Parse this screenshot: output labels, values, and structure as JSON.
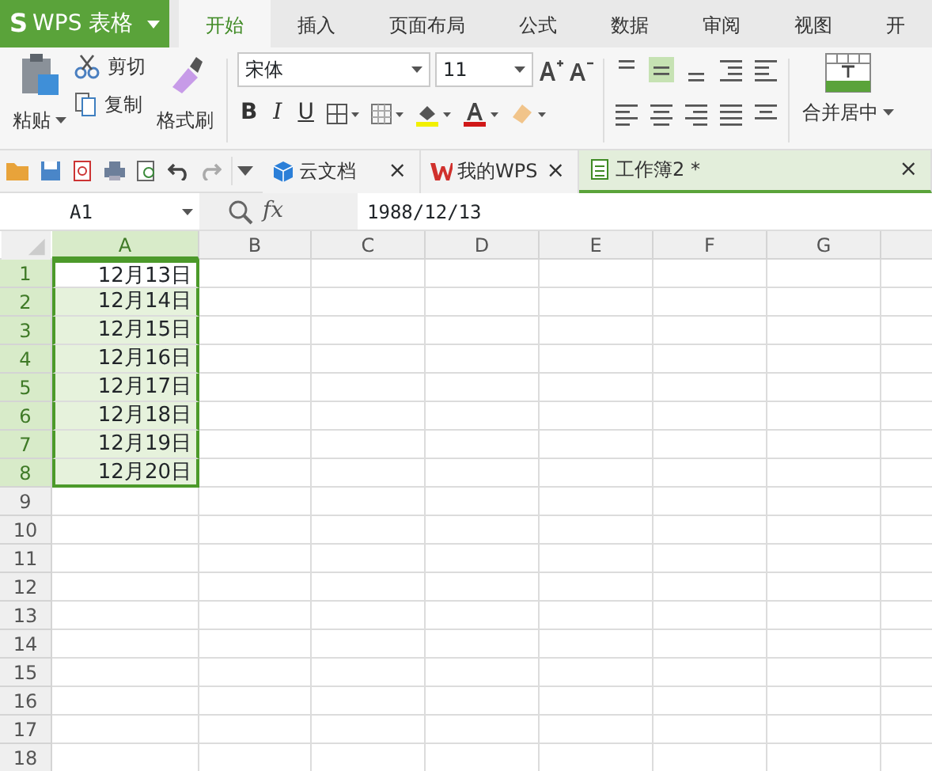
{
  "app": {
    "logo": "S",
    "title": "WPS 表格"
  },
  "ribbon_tabs": [
    {
      "label": "开始",
      "selected": true
    },
    {
      "label": "插入",
      "selected": false
    },
    {
      "label": "页面布局",
      "selected": false
    },
    {
      "label": "公式",
      "selected": false
    },
    {
      "label": "数据",
      "selected": false
    },
    {
      "label": "审阅",
      "selected": false
    },
    {
      "label": "视图",
      "selected": false
    },
    {
      "label": "开",
      "selected": false
    }
  ],
  "clipboard": {
    "paste": "粘贴",
    "cut": "剪切",
    "copy": "复制",
    "format_painter": "格式刷"
  },
  "font": {
    "name": "宋体",
    "size": "11",
    "bold": "B",
    "italic": "I",
    "underline": "U"
  },
  "merge": "合并居中",
  "doc_tabs": [
    {
      "label": "云文档",
      "close": "×",
      "selected": false
    },
    {
      "label": "我的WPS",
      "close": "×",
      "selected": false
    },
    {
      "label": "工作簿2 *",
      "close": "×",
      "selected": true
    }
  ],
  "name_box": "A1",
  "fx": "fx",
  "formula": "1988/12/13",
  "sheet": {
    "columns": [
      {
        "label": "A",
        "selected": true
      },
      {
        "label": "B",
        "selected": false
      },
      {
        "label": "C",
        "selected": false
      },
      {
        "label": "D",
        "selected": false
      },
      {
        "label": "E",
        "selected": false
      },
      {
        "label": "F",
        "selected": false
      },
      {
        "label": "G",
        "selected": false
      }
    ],
    "rows": [
      {
        "label": "1",
        "selected": true,
        "cells": [
          {
            "text": "12月13日",
            "active": true
          }
        ]
      },
      {
        "label": "2",
        "selected": true,
        "cells": [
          {
            "text": "12月14日",
            "active": false
          }
        ]
      },
      {
        "label": "3",
        "selected": true,
        "cells": [
          {
            "text": "12月15日",
            "active": false
          }
        ]
      },
      {
        "label": "4",
        "selected": true,
        "cells": [
          {
            "text": "12月16日",
            "active": false
          }
        ]
      },
      {
        "label": "5",
        "selected": true,
        "cells": [
          {
            "text": "12月17日",
            "active": false
          }
        ]
      },
      {
        "label": "6",
        "selected": true,
        "cells": [
          {
            "text": "12月18日",
            "active": false
          }
        ]
      },
      {
        "label": "7",
        "selected": true,
        "cells": [
          {
            "text": "12月19日",
            "active": false
          }
        ]
      },
      {
        "label": "8",
        "selected": true,
        "cells": [
          {
            "text": "12月20日",
            "active": false
          }
        ]
      },
      {
        "label": "9",
        "selected": false
      },
      {
        "label": "10",
        "selected": false
      },
      {
        "label": "11",
        "selected": false
      },
      {
        "label": "12",
        "selected": false
      },
      {
        "label": "13",
        "selected": false
      },
      {
        "label": "14",
        "selected": false
      },
      {
        "label": "15",
        "selected": false
      },
      {
        "label": "16",
        "selected": false
      },
      {
        "label": "17",
        "selected": false
      },
      {
        "label": "18",
        "selected": false
      }
    ]
  }
}
